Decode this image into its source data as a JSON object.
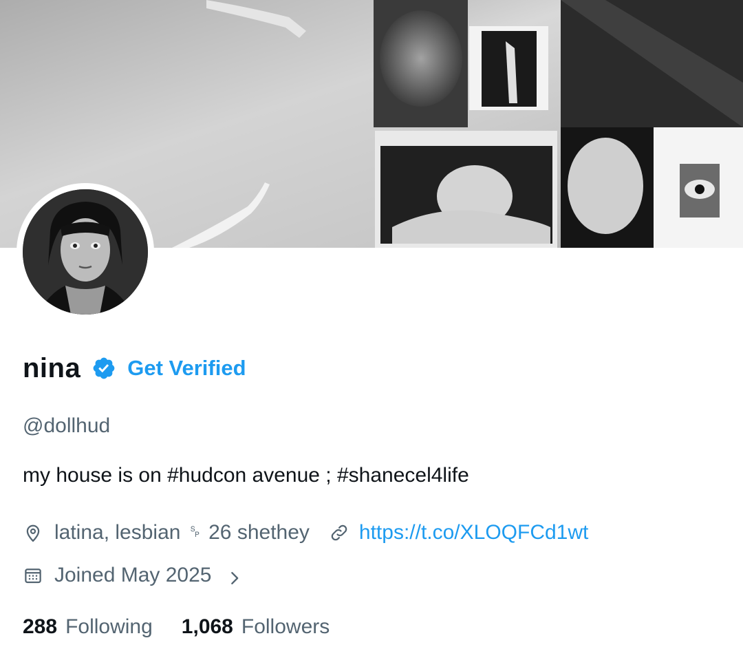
{
  "profile": {
    "display_name": "nina",
    "verify_cta": "Get Verified",
    "handle": "@dollhud",
    "bio": "my house is on #hudcon avenue ; #shanecel4life",
    "location": "latina, lesbian ␠ 26  shethey",
    "website": "https://t.co/XLOQFCd1wt",
    "joined": "Joined May 2025",
    "following_count": "288",
    "following_label": "Following",
    "followers_count": "1,068",
    "followers_label": "Followers"
  },
  "icons": {
    "verified": "verified-badge-icon",
    "location": "location-pin-icon",
    "link": "link-icon",
    "calendar": "calendar-icon",
    "chevron": "chevron-right-icon"
  },
  "colors": {
    "accent": "#1d9bf0",
    "secondary_text": "#536471",
    "primary_text": "#0f1419"
  }
}
